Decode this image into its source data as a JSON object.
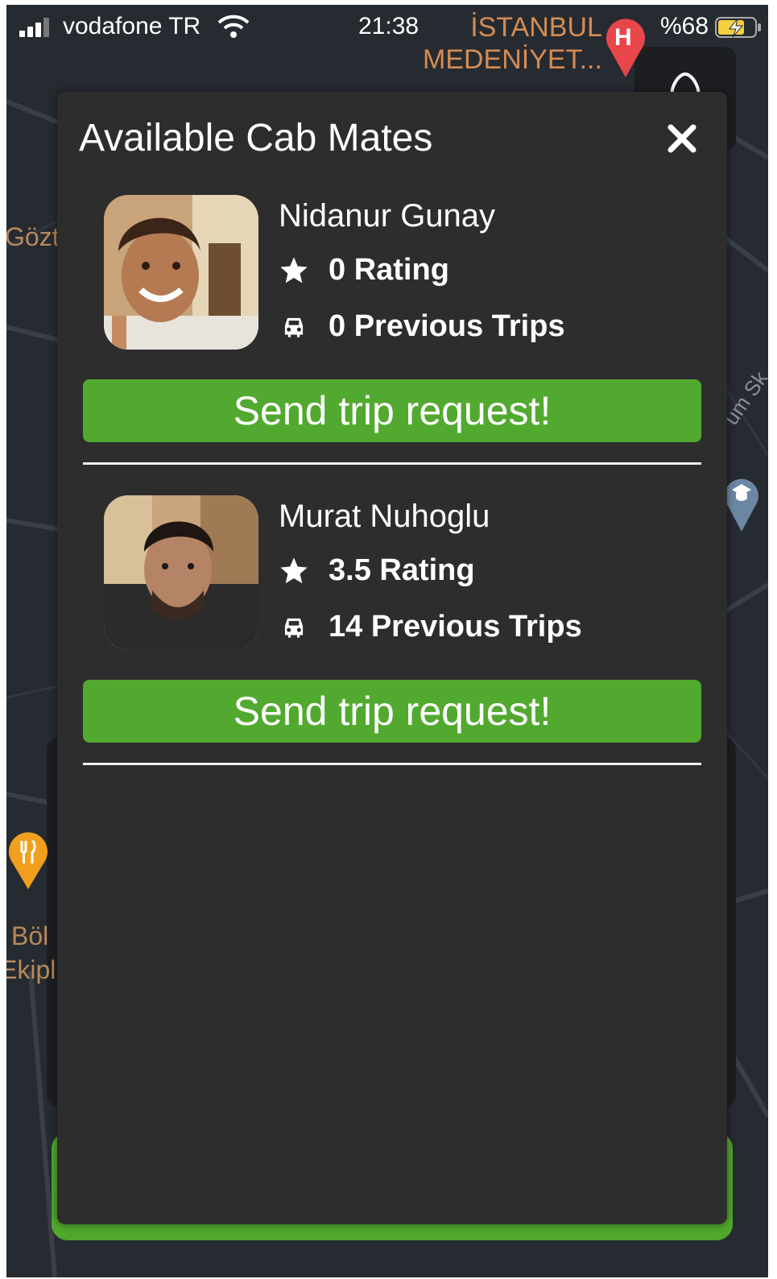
{
  "status_bar": {
    "carrier": "vodafone TR",
    "time": "21:38",
    "battery_percent": "%68",
    "location_line1": "İSTANBUL",
    "location_line2": "MEDENİYET..."
  },
  "map": {
    "labels": [
      "Gözt",
      "Böl",
      "Ekipl"
    ],
    "street": "um Sk."
  },
  "modal": {
    "title": "Available Cab Mates",
    "mates": [
      {
        "name": "Nidanur Gunay",
        "rating": "0 Rating",
        "trips": "0 Previous Trips",
        "button": "Send trip request!"
      },
      {
        "name": "Murat Nuhoglu",
        "rating": "3.5 Rating",
        "trips": "14 Previous Trips",
        "button": "Send trip request!"
      }
    ]
  },
  "colors": {
    "accent_green": "#52a92f",
    "modal_bg": "#2d2d2d",
    "map_label": "#d48c52"
  },
  "icons": {
    "close": "close-icon",
    "rating": "star-icon",
    "trips": "car-icon"
  }
}
